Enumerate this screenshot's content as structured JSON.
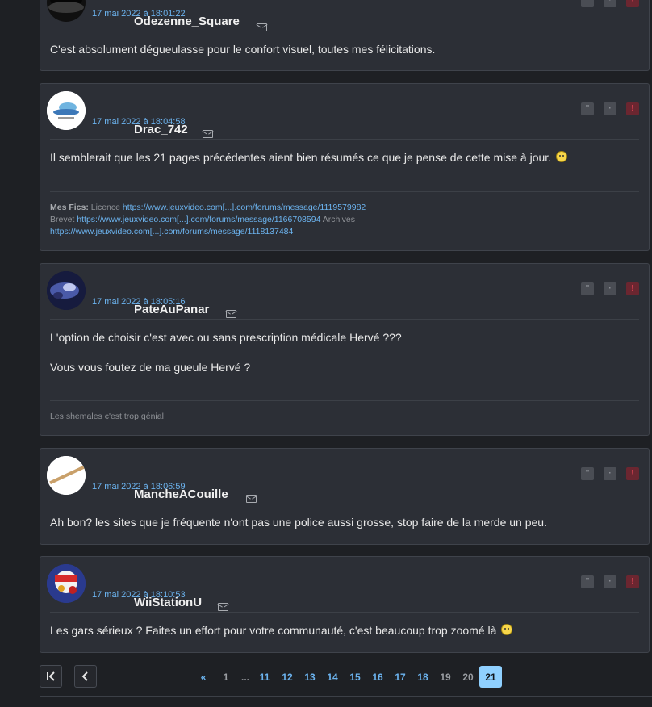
{
  "posts": [
    {
      "timestamp": "17 mai 2022 à 18:01:22",
      "pseudo": "Odezenne_Square",
      "message": "C'est absolument dégueulasse pour le confort visuel, toutes mes félicitations."
    },
    {
      "timestamp": "17 mai 2022 à 18:04:58",
      "pseudo": "Drac_742",
      "message": "Il semblerait que les 21 pages précédentes aient bien résumés ce que je pense de cette mise à jour.",
      "signature": {
        "label": "Mes Fics:",
        "licence_text": "Licence",
        "licence_link": "https://www.jeuxvideo.com[...].com/forums/message/1119579982",
        "brevet_text": "Brevet",
        "brevet_link": "https://www.jeuxvideo.com[...].com/forums/message/1166708594",
        "archives_text": "Archives",
        "archives_link": "https://www.jeuxvideo.com[...].com/forums/message/1118137484"
      }
    },
    {
      "timestamp": "17 mai 2022 à 18:05:16",
      "pseudo": "PateAuPanar",
      "message_line1": "L'option de choisir c'est avec ou sans prescription médicale Hervé ???",
      "message_line2": "Vous vous foutez de ma gueule Hervé ?",
      "signature": "Les shemales c'est trop génial"
    },
    {
      "timestamp": "17 mai 2022 à 18:06:59",
      "pseudo": "MancheACouille",
      "message": "Ah bon? les sites que je fréquente n'ont pas une police aussi grosse, stop faire de la merde un peu."
    },
    {
      "timestamp": "17 mai 2022 à 18:10:53",
      "pseudo": "WiiStationU",
      "message": "Les gars sérieux ? Faites un effort pour votre communauté, c'est beaucoup trop zoomé là"
    }
  ],
  "actions": {
    "quote": "\"",
    "delete": "·",
    "alert": "!"
  },
  "pagination": {
    "prev_symbol": "«",
    "first": "1",
    "ellipsis": "...",
    "pages": [
      "11",
      "12",
      "13",
      "14",
      "15",
      "16",
      "17",
      "18"
    ],
    "muted_pages": [
      "19",
      "20"
    ],
    "current": "21"
  },
  "colors": {
    "link": "#6cb4f0",
    "current_page_bg": "#8fd0ff",
    "alert": "#f04a5a"
  }
}
